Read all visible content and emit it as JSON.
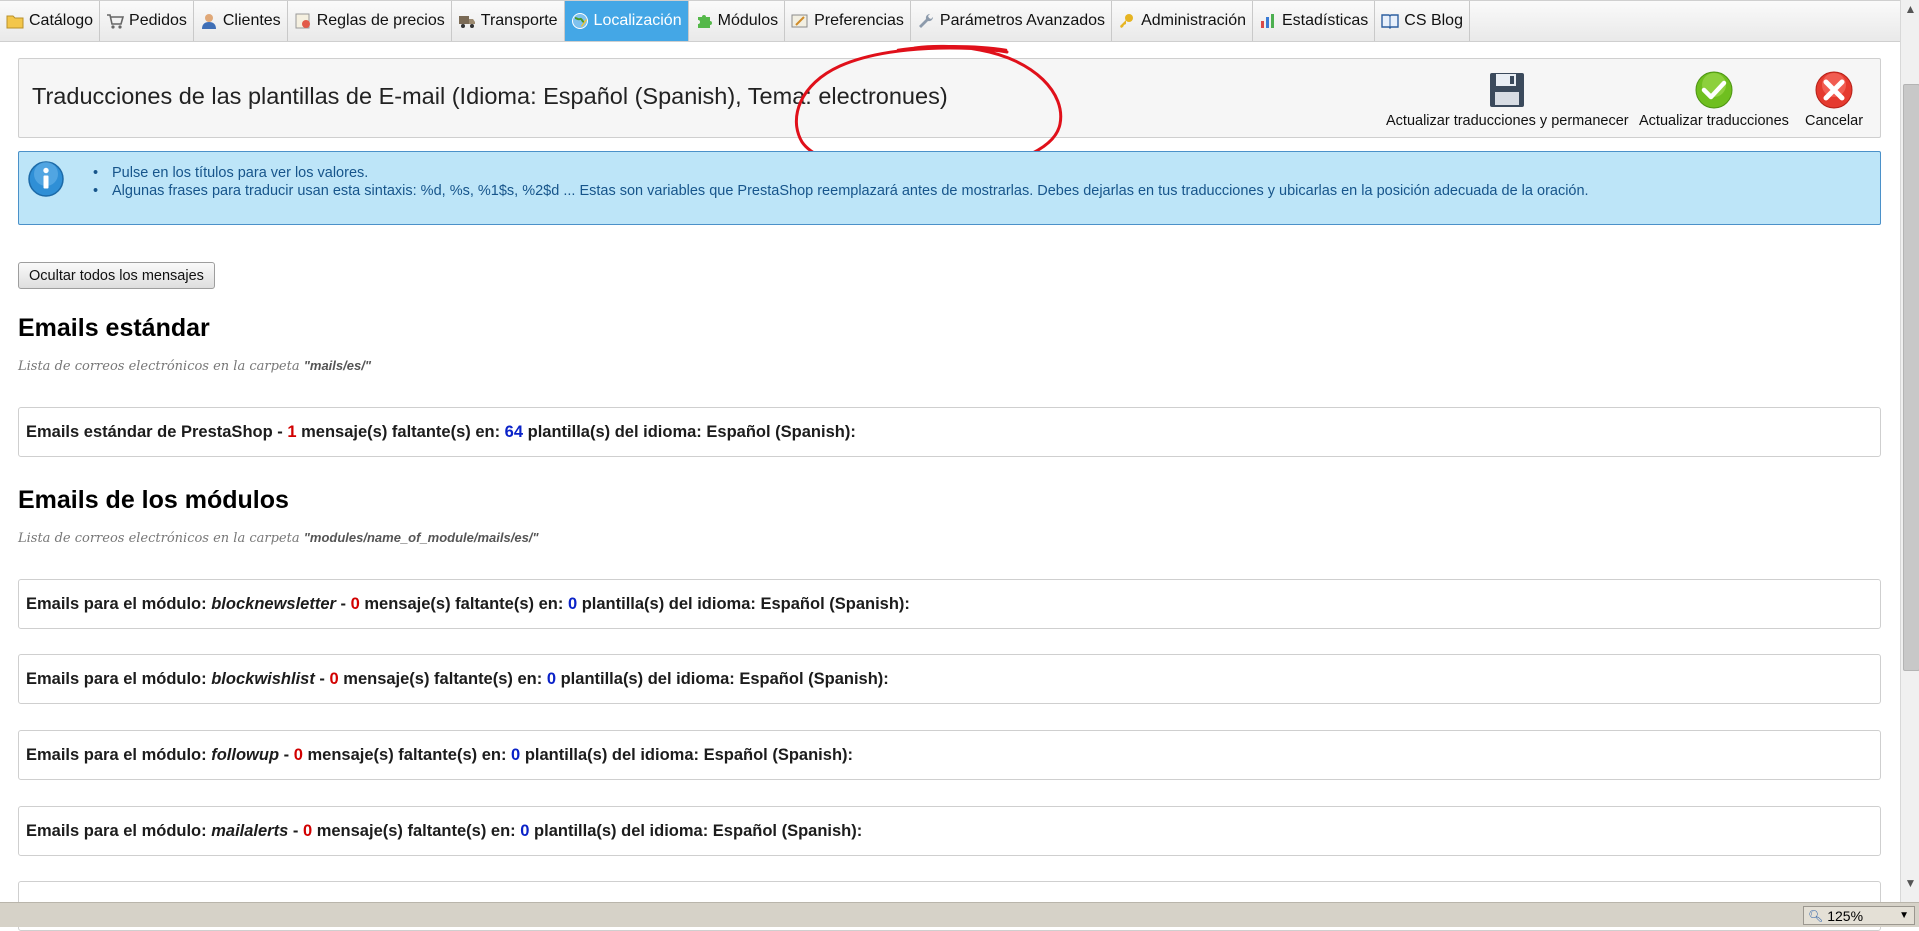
{
  "nav": {
    "tabs": [
      {
        "label": "Catálogo",
        "icon": "folder-icon"
      },
      {
        "label": "Pedidos",
        "icon": "cart-icon"
      },
      {
        "label": "Clientes",
        "icon": "user-icon"
      },
      {
        "label": "Reglas de precios",
        "icon": "price-rules-icon"
      },
      {
        "label": "Transporte",
        "icon": "truck-icon"
      },
      {
        "label": "Localización",
        "icon": "globe-icon",
        "active": true
      },
      {
        "label": "Módulos",
        "icon": "puzzle-icon"
      },
      {
        "label": "Preferencias",
        "icon": "preferences-icon"
      },
      {
        "label": "Parámetros Avanzados",
        "icon": "wrench-icon"
      },
      {
        "label": "Administración",
        "icon": "key-icon"
      },
      {
        "label": "Estadísticas",
        "icon": "chart-icon"
      },
      {
        "label": "CS Blog",
        "icon": "book-icon"
      }
    ]
  },
  "header": {
    "title": "Traducciones de las plantillas de E-mail (Idioma: Español (Spanish), Tema: electronues)",
    "buttons": {
      "save_stay": "Actualizar traducciones y permanecer",
      "save": "Actualizar traducciones",
      "cancel": "Cancelar"
    }
  },
  "info": {
    "items": [
      "Pulse en los títulos para ver los valores.",
      "Algunas frases para traducir usan esta sintaxis: %d, %s, %1$s, %2$d ... Estas son variables que PrestaShop reemplazará antes de mostrarlas. Debes dejarlas en tus traducciones y ubicarlas en la posición adecuada de la oración."
    ]
  },
  "hide_all_label": "Ocultar todos los mensajes",
  "standard": {
    "heading": "Emails estándar",
    "sub_prefix": "Lista de correos electrónicos en la carpeta",
    "folder": "\"mails/es/\"",
    "row": {
      "prefix": "Emails estándar de PrestaShop - ",
      "missing": "1",
      "mid": " mensaje(s) faltante(s) en: ",
      "templates": "64",
      "suffix": " plantilla(s) del idioma: Español (Spanish):"
    }
  },
  "modules": {
    "heading": "Emails de los módulos",
    "sub_prefix": "Lista de correos electrónicos en la carpeta",
    "folder": "\"modules/name_of_module/mails/es/\"",
    "row_prefix": "Emails para el módulo: ",
    "row_mid": " mensaje(s) faltante(s) en: ",
    "row_suffix": " plantilla(s) del idioma: Español (Spanish):",
    "rows": [
      {
        "module": "blocknewsletter",
        "missing": "0",
        "templates": "0"
      },
      {
        "module": "blockwishlist",
        "missing": "0",
        "templates": "0"
      },
      {
        "module": "followup",
        "missing": "0",
        "templates": "0"
      },
      {
        "module": "mailalerts",
        "missing": "0",
        "templates": "0"
      }
    ]
  },
  "status": {
    "zoom": "125%"
  },
  "colors": {
    "active_tab": "#44a7e6",
    "info_bg": "#bde5f8",
    "missing": "#d10000",
    "templates": "#0a22c8",
    "annotation": "#e0101a"
  }
}
